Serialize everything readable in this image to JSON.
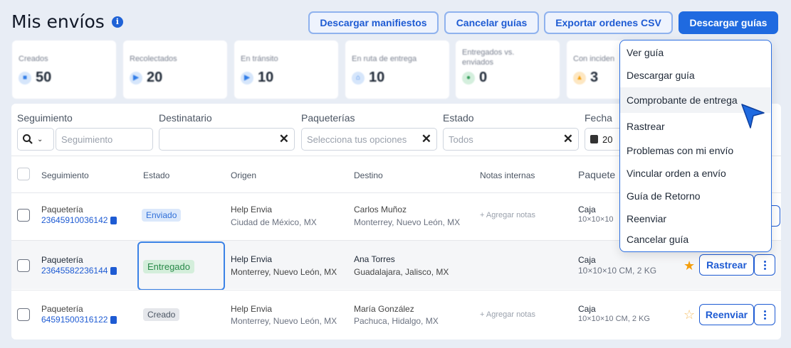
{
  "header": {
    "title": "Mis envíos",
    "buttons": {
      "download_manifests": "Descargar manifiestos",
      "cancel_labels": "Cancelar guías",
      "export_csv": "Exportar ordenes CSV",
      "download_labels": "Descargar guías"
    }
  },
  "stats": [
    {
      "label": "Creados",
      "value": "50",
      "icon": "box-icon",
      "color": "#2f7ce8"
    },
    {
      "label": "Recolectados",
      "value": "20",
      "icon": "truck-icon",
      "color": "#2f7ce8"
    },
    {
      "label": "En tránsito",
      "value": "10",
      "icon": "truck-icon",
      "color": "#2f7ce8"
    },
    {
      "label": "En ruta de entrega",
      "value": "10",
      "icon": "home-icon",
      "color": "#2f7ce8"
    },
    {
      "label": "Entregados vs. enviados",
      "value": "0",
      "icon": "people-icon",
      "color": "#2f9a55"
    },
    {
      "label": "Con inciden",
      "value": "3",
      "icon": "warning-icon",
      "color": "#f59e0b"
    }
  ],
  "filters": {
    "tracking_label": "Seguimiento",
    "tracking_placeholder": "Seguimiento",
    "recipient_label": "Destinatario",
    "carrier_label": "Paqueterías",
    "carrier_placeholder": "Selecciona tus opciones",
    "status_label": "Estado",
    "status_value": "Todos",
    "date_label": "Fecha",
    "date_value": "20"
  },
  "table": {
    "headers": {
      "tracking": "Seguimiento",
      "status": "Estado",
      "origin": "Origen",
      "destination": "Destino",
      "notes": "Notas internas",
      "package": "Paquete"
    },
    "rows": [
      {
        "carrier": "Paquetería",
        "tracking": "23645910036142",
        "status": "Enviado",
        "origin_name": "Help Envia",
        "origin_place": "Ciudad de México, MX",
        "dest_name": "Carlos Muñoz",
        "dest_place": "Monterrey, Nuevo León, MX",
        "notes": "+ Agregar notas",
        "pkg_type": "Caja",
        "pkg_dims": "10×10×10"
      },
      {
        "carrier": "Paquetería",
        "tracking": "23645582236144",
        "status": "Entregado",
        "origin_name": "Help Envia",
        "origin_place": "Monterrey, Nuevo León, MX",
        "dest_name": "Ana Torres",
        "dest_place": "Guadalajara, Jalisco, MX",
        "notes": "",
        "pkg_type": "Caja",
        "pkg_dims": "10×10×10 CM, 2 KG",
        "action": "Rastrear"
      },
      {
        "carrier": "Paquetería",
        "tracking": "64591500316122",
        "status": "Creado",
        "origin_name": "Help Envia",
        "origin_place": "Monterrey, Nuevo León, MX",
        "dest_name": "María González",
        "dest_place": "Pachuca, Hidalgo, MX",
        "notes": "+ Agregar notas",
        "pkg_type": "Caja",
        "pkg_dims": "10×10×10 CM, 2 KG",
        "action": "Reenviar"
      }
    ]
  },
  "menu": {
    "items": [
      "Ver guía",
      "Descargar guía",
      "Comprobante de entrega",
      "Rastrear",
      "Problemas con mi envío",
      "Vincular orden a envío",
      "Guía de Retorno",
      "Reenviar",
      "Cancelar guía"
    ]
  }
}
